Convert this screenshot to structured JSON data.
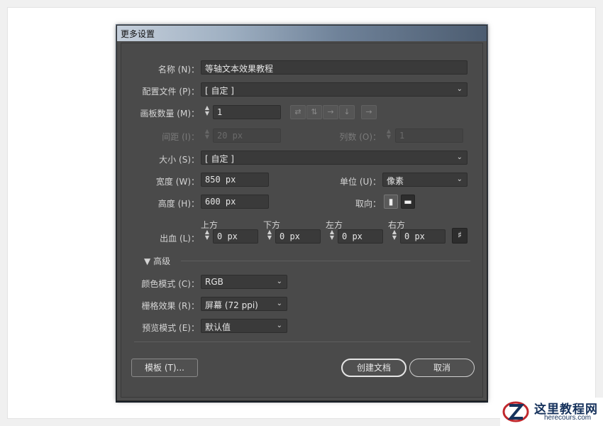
{
  "dialog": {
    "title": "更多设置"
  },
  "fields": {
    "name": {
      "label": "名称",
      "shortcut_display": "(N)：",
      "value": "等轴文本效果教程"
    },
    "profile": {
      "label": "配置文件",
      "shortcut_display": "(P)：",
      "value": "[ 自定 ]"
    },
    "artboards": {
      "label": "画板数量",
      "shortcut_display": "(M)：",
      "value": "1"
    },
    "spacing": {
      "label": "间距",
      "shortcut_display": "(I)：",
      "value": "20 px"
    },
    "columns": {
      "label": "列数",
      "shortcut_display": "(O)：",
      "value": "1"
    },
    "size": {
      "label": "大小",
      "shortcut_display": "(S)：",
      "value": "[ 自定 ]"
    },
    "width": {
      "label": "宽度",
      "shortcut_display": "(W)：",
      "value": "850 px"
    },
    "height": {
      "label": "高度",
      "shortcut_display": "(H)：",
      "value": "600 px"
    },
    "units": {
      "label": "单位",
      "shortcut_display": "(U)：",
      "value": "像素"
    },
    "orientation": {
      "label": "取向："
    },
    "bleed": {
      "label": "出血",
      "shortcut_display": "(L)：",
      "top": {
        "label": "上方",
        "value": "0 px"
      },
      "bottom": {
        "label": "下方",
        "value": "0 px"
      },
      "left": {
        "label": "左方",
        "value": "0 px"
      },
      "right": {
        "label": "右方",
        "value": "0 px"
      }
    }
  },
  "advanced": {
    "label": "高级",
    "color_mode": {
      "label": "颜色模式",
      "shortcut_display": "(C)：",
      "value": "RGB"
    },
    "raster": {
      "label": "栅格效果",
      "shortcut_display": "(R)：",
      "value": "屏幕 (72 ppi)"
    },
    "preview": {
      "label": "预览模式",
      "shortcut_display": "(E)：",
      "value": "默认值"
    }
  },
  "buttons": {
    "templates": "模板 (T)...",
    "create": "创建文档",
    "cancel": "取消"
  },
  "spinner_glyphs": {
    "up": "▲",
    "down": "▼"
  },
  "watermark": {
    "cn": "这里教程网",
    "en": "herecours.com"
  },
  "colors": {
    "dialog_bg": "#4d4d4d",
    "field_bg": "#3a3a3a",
    "text": "#d6d6d6"
  }
}
